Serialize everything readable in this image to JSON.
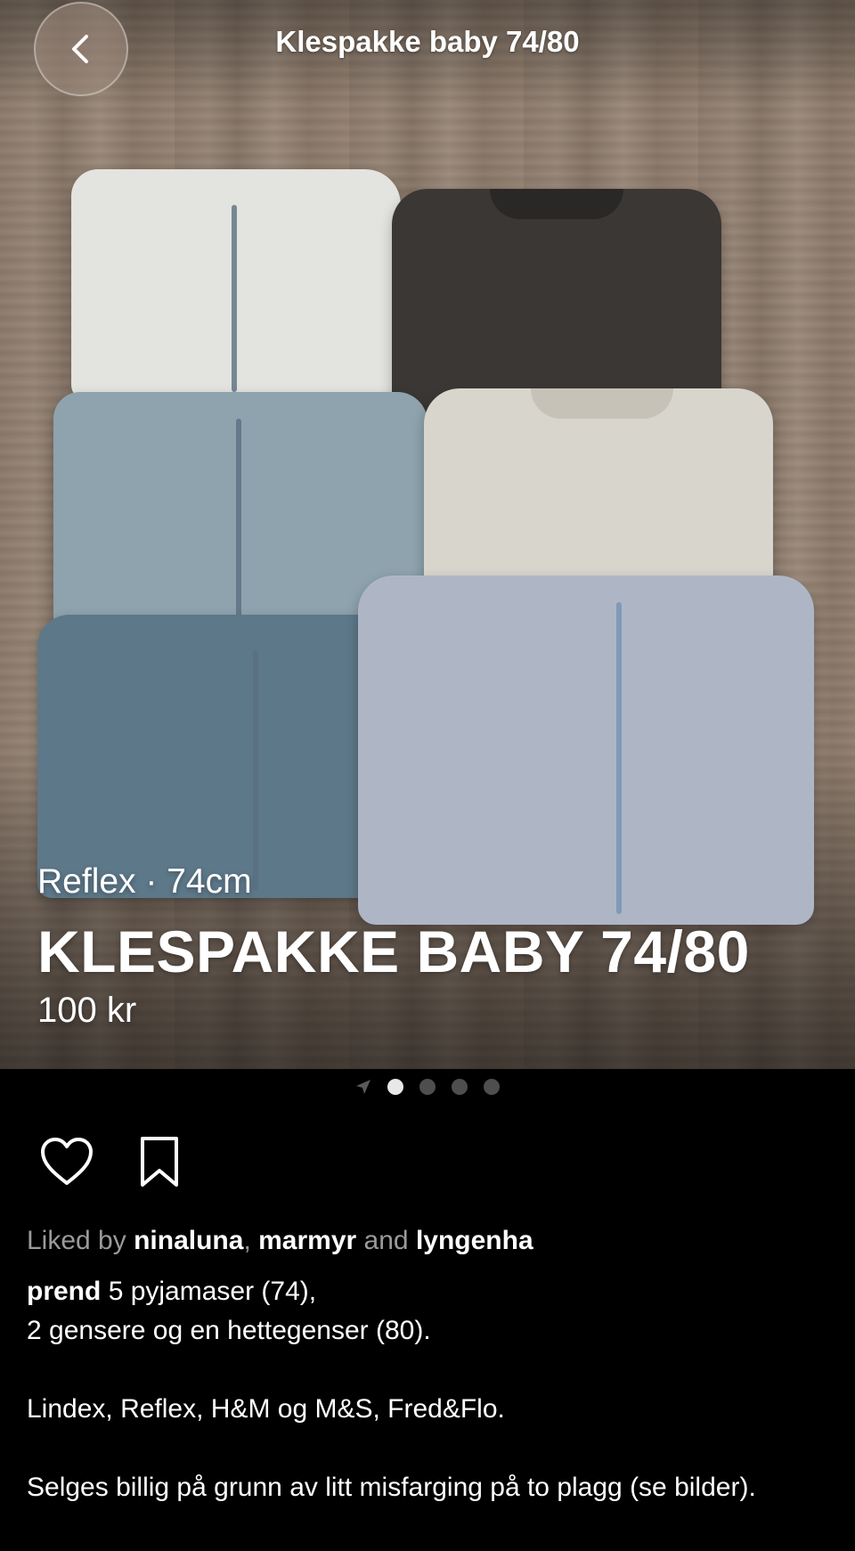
{
  "header": {
    "title": "Klespakke baby 74/80"
  },
  "listing": {
    "brand": "Reflex",
    "separator": "·",
    "size": "74cm",
    "name": "KLESPAKKE BABY 74/80",
    "price": "100 kr"
  },
  "pager": {
    "total_pages": 4,
    "active_index": 0
  },
  "actions": {
    "like_icon": "heart-icon",
    "save_icon": "bookmark-icon"
  },
  "likes": {
    "prefix": "Liked by",
    "users": [
      "ninaluna",
      "marmyr",
      "lyngenha"
    ],
    "comma": ",",
    "conjunction": "and"
  },
  "caption": {
    "author": "prend",
    "line1": "5 pyjamaser (74),",
    "line2": "2 gensere og en hettegenser (80).",
    "line3": "Lindex, Reflex, H&M og M&S, Fred&Flo.",
    "line4": "Selges billig på grunn av litt misfarging på to plagg (se bilder)."
  },
  "colors": {
    "background": "#000000",
    "text": "#ffffff",
    "muted": "#9a9a9a",
    "dot_active": "#e8e8e8",
    "dot_inactive": "#4e4e4e"
  }
}
